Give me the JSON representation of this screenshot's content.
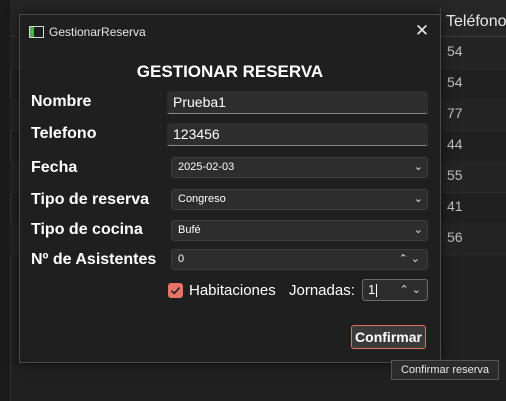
{
  "background_table": {
    "header_label": "Teléfono",
    "rows": [
      "54",
      "54",
      "77",
      "44",
      "55",
      "41",
      "56"
    ]
  },
  "dialog": {
    "window_title": "GestionarReserva",
    "close_glyph": "✕",
    "heading": "GESTIONAR RESERVA",
    "fields": {
      "nombre": {
        "label": "Nombre",
        "value": "Prueba1"
      },
      "telefono": {
        "label": "Telefono",
        "value": "123456"
      },
      "fecha": {
        "label": "Fecha",
        "value": "2025-02-03"
      },
      "tipo_reserva": {
        "label": "Tipo de reserva",
        "value": "Congreso"
      },
      "tipo_cocina": {
        "label": "Tipo de cocina",
        "value": "Bufé"
      },
      "asistentes": {
        "label": "Nº de Asistentes",
        "value": "0"
      }
    },
    "habitaciones": {
      "label": "Habitaciones",
      "checked": true
    },
    "jornadas": {
      "label": "Jornadas:",
      "value": "1"
    },
    "confirm_label": "Confirmar"
  },
  "tooltip": "Confirmar reserva",
  "colors": {
    "accent": "#e57368",
    "background": "#1f1f1f",
    "field": "#2d2d2d"
  }
}
